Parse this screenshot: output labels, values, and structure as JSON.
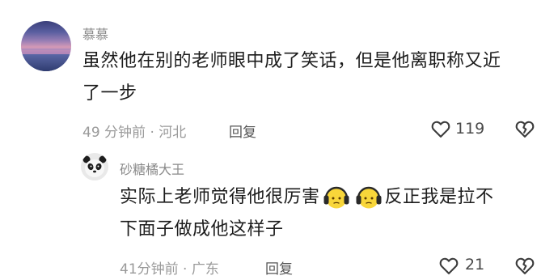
{
  "comment": {
    "username": "慕慕",
    "line1": "虽然他在别的老师眼中成了笑话，但是他离职称又近",
    "line2": "了一步",
    "time": "49 分钟前 · 河北",
    "reply_label": "回复",
    "likes": "119"
  },
  "reply": {
    "username": "砂糖橘大王",
    "line1_a": "实际上老师觉得他很厉害",
    "line1_b": "反正我是拉不",
    "line2": "下面子做成他这样子",
    "time": "41分钟前 · 广东",
    "reply_label": "回复",
    "likes": "21"
  },
  "icons": {
    "like": "heart-outline-icon",
    "dislike": "broken-heart-icon",
    "emoji": "headphone-face-emoji"
  }
}
